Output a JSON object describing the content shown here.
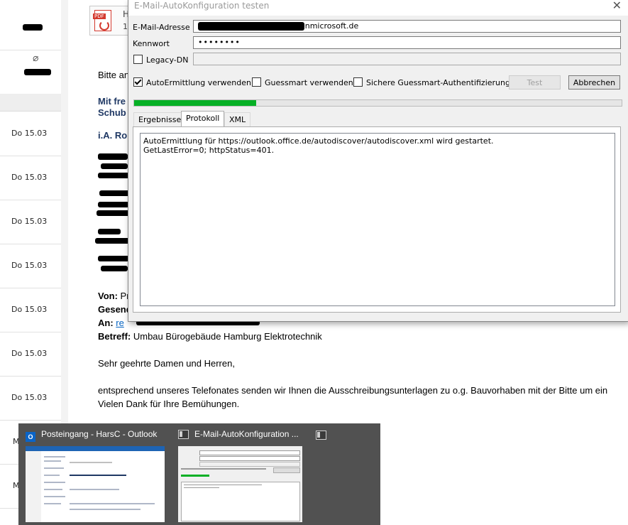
{
  "message_list": {
    "rows": [
      {
        "date": "",
        "redacted": true
      },
      {
        "date": "",
        "redacted": true,
        "attachment": true
      },
      {
        "date": "Do 15.03"
      },
      {
        "date": "Do 15.03"
      },
      {
        "date": "Do 15.03"
      },
      {
        "date": "Do 15.03"
      },
      {
        "date": "Do 15.03"
      },
      {
        "date": "Do 15.03"
      },
      {
        "date": "Do 15.03"
      },
      {
        "date": "M"
      },
      {
        "date": "M"
      }
    ]
  },
  "reading_pane": {
    "attachment": {
      "line1": "H",
      "line2": "1"
    },
    "greeting_partial": "Bitte an",
    "signature": {
      "line1": "Mit fre",
      "line2": "Schub",
      "line3": "i.A. Ro"
    },
    "headers": {
      "von_label": "Von:",
      "von_value": "Pr",
      "gesendet_label": "Gesend",
      "an_label": "An:",
      "an_value": "re",
      "betreff_label": "Betreff:",
      "betreff_value": "Umbau Bürogebäude Hamburg Elektrotechnik"
    },
    "body": {
      "salutation": "Sehr geehrte Damen und Herren,",
      "line1": "entsprechend unseres Telefonates senden wir Ihnen die Ausschreibungsunterlagen zu o.g. Bauvorhaben mit der Bitte um ein",
      "line2": "Vielen Dank für Ihre Bemühungen."
    }
  },
  "dialog": {
    "title": "E-Mail-AutoKonfiguration testen",
    "email_label": "E-Mail-Adresse",
    "email_value_visible": "onmicrosoft.de",
    "password_label": "Kennwort",
    "password_value": "••••••••",
    "legacy_dn_label": "Legacy-DN",
    "legacy_dn_checked": false,
    "options": {
      "autodiscover": {
        "label": "AutoErmittlung verwenden",
        "checked": true
      },
      "guessmart": {
        "label": "Guessmart verwenden",
        "checked": false
      },
      "secure_guessmart": {
        "label": "Sichere Guessmart-Authentifizierung",
        "checked": false
      }
    },
    "test_button": "Test",
    "cancel_button": "Abbrechen",
    "progress_percent": 25,
    "tabs": [
      {
        "label": "Ergebnisse",
        "active": false
      },
      {
        "label": "Protokoll",
        "active": true
      },
      {
        "label": "XML",
        "active": false
      }
    ],
    "log_lines": [
      "AutoErmittlung für https://outlook.office.de/autodiscover/autodiscover.xml wird gestartet.",
      "GetLastError=0; httpStatus=401."
    ]
  },
  "taskbar_preview": {
    "windows": [
      {
        "title": "Posteingang - HarsC - Outlook",
        "icon": "outlook-icon"
      },
      {
        "title": "E-Mail-AutoKonfiguration ...",
        "icon": "window-icon"
      }
    ]
  },
  "colors": {
    "progress_green": "#06b025",
    "taskbar_bg": "#515151",
    "signature_blue": "#1f3864"
  }
}
